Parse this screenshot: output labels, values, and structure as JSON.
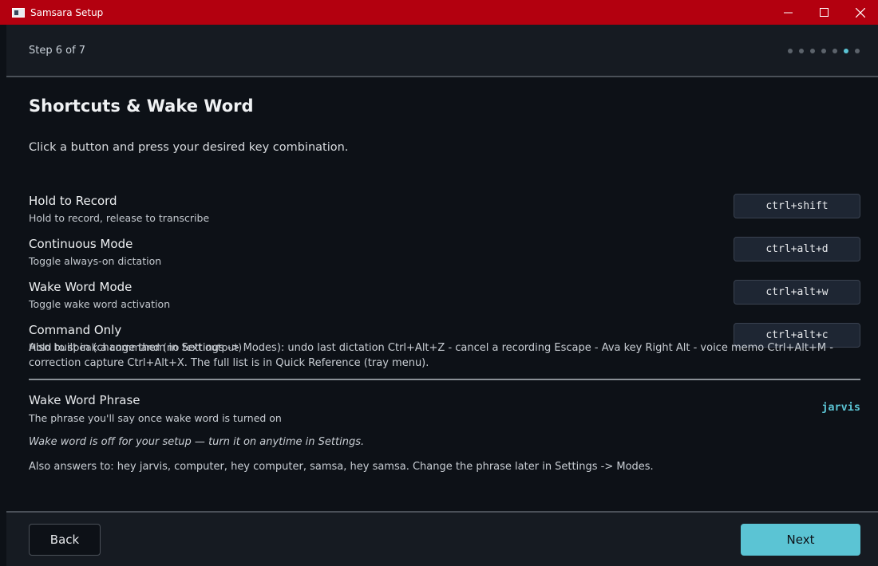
{
  "window": {
    "title": "Samsara Setup",
    "controls": [
      "minimize-icon",
      "maximize-icon",
      "close-icon"
    ]
  },
  "stepbar": {
    "label": "Step 6 of 7",
    "total_steps": 7,
    "current_step": 6,
    "accent_color": "#5bc4d4"
  },
  "page": {
    "title": "Shortcuts & Wake Word",
    "instructions": "Click a button and press your desired key combination."
  },
  "shortcuts": [
    {
      "name": "Hold to Record",
      "description": "Hold to record, release to transcribe",
      "key": "ctrl+shift"
    },
    {
      "name": "Continuous Mode",
      "description": "Toggle always-on dictation",
      "key": "ctrl+alt+d"
    },
    {
      "name": "Wake Word Mode",
      "description": "Toggle wake word activation",
      "key": "ctrl+alt+w"
    },
    {
      "name": "Command Only",
      "description": "Hold to speak a command (no text output)",
      "key": "ctrl+alt+c"
    }
  ],
  "builtin_note": "Also built in (change them in Settings -> Modes): undo last dictation Ctrl+Alt+Z - cancel a recording Escape - Ava key Right Alt - voice memo Ctrl+Alt+M - correction capture Ctrl+Alt+X. The full list is in Quick Reference (tray menu).",
  "wake_word": {
    "name": "Wake Word Phrase",
    "description": "The phrase you'll say once wake word is turned on",
    "value": "jarvis",
    "status": "Wake word is off for your setup — turn it on anytime in Settings.",
    "aliases": "Also answers to: hey jarvis, computer, hey computer, samsa, hey samsa. Change the phrase later in Settings -> Modes."
  },
  "footer": {
    "back_label": "Back",
    "next_label": "Next"
  },
  "colors": {
    "titlebar": "#b3000f",
    "background": "#0d1117",
    "accent": "#5bc4d4"
  }
}
